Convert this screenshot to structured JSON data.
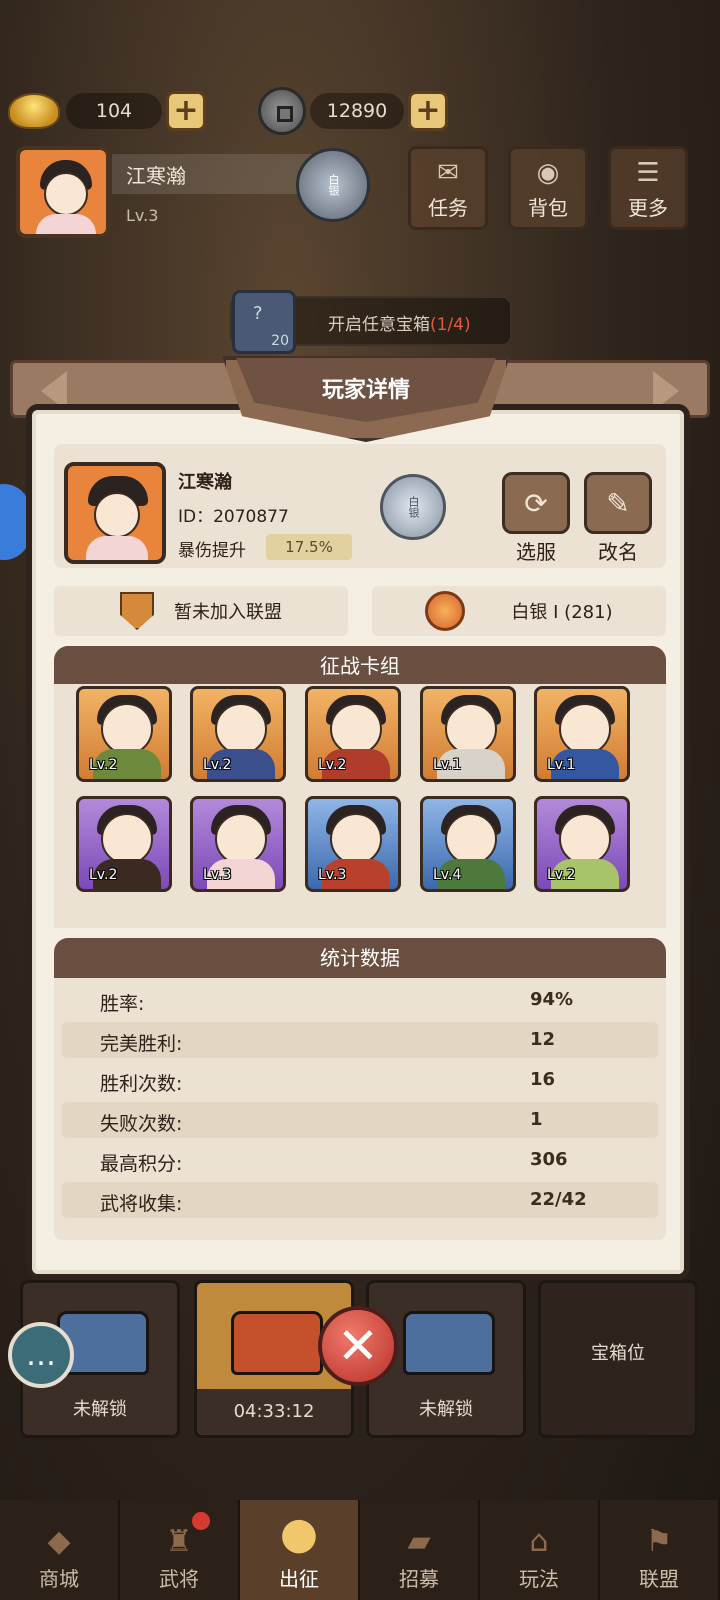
{
  "currency": {
    "ingot_value": "104",
    "coin_value": "12890"
  },
  "player_bar": {
    "name": "江寒瀚",
    "level": "Lv.3",
    "rank_label": "白银"
  },
  "top_buttons": [
    {
      "label": "任务"
    },
    {
      "label": "背包"
    },
    {
      "label": "更多"
    }
  ],
  "chest_task": {
    "icon_count": "20",
    "text": "开启任意宝箱",
    "progress": "(1/4)"
  },
  "panel": {
    "title": "玩家详情",
    "name": "江寒瀚",
    "id_text": "ID：2070877",
    "crit_label": "暴伤提升",
    "crit_value": "17.5%",
    "rank_label": "白银",
    "select_server": "选服",
    "rename": "改名",
    "alliance": "暂未加入联盟",
    "league": "白银 I (281)"
  },
  "deck": {
    "title": "征战卡组",
    "cards": [
      {
        "level": "Lv.2",
        "rarity": "orange"
      },
      {
        "level": "Lv.2",
        "rarity": "orange"
      },
      {
        "level": "Lv.2",
        "rarity": "orange"
      },
      {
        "level": "Lv.1",
        "rarity": "orange"
      },
      {
        "level": "Lv.1",
        "rarity": "orange"
      },
      {
        "level": "Lv.2",
        "rarity": "purple"
      },
      {
        "level": "Lv.3",
        "rarity": "purple"
      },
      {
        "level": "Lv.3",
        "rarity": "blue"
      },
      {
        "level": "Lv.4",
        "rarity": "blue"
      },
      {
        "level": "Lv.2",
        "rarity": "purple"
      }
    ]
  },
  "stats": {
    "title": "统计数据",
    "rows": [
      {
        "label": "胜率:",
        "value": "94%"
      },
      {
        "label": "完美胜利:",
        "value": "12"
      },
      {
        "label": "胜利次数:",
        "value": "16"
      },
      {
        "label": "失败次数:",
        "value": "1"
      },
      {
        "label": "最高积分:",
        "value": "306"
      },
      {
        "label": "武将收集:",
        "value": "22/42"
      }
    ]
  },
  "chest_slots": [
    {
      "label": "未解锁"
    },
    {
      "label": "04:33:12"
    },
    {
      "label": "未解锁"
    },
    {
      "label": "宝箱位"
    }
  ],
  "bottom_nav": [
    {
      "label": "商城"
    },
    {
      "label": "武将"
    },
    {
      "label": "出征"
    },
    {
      "label": "招募"
    },
    {
      "label": "玩法"
    },
    {
      "label": "联盟"
    }
  ],
  "colors": {
    "orange_card": "#d07d34",
    "purple_card": "#7c4ab8",
    "blue_card": "#3b69ad",
    "accent_gold": "#e1d19e",
    "close_red": "#b8302a"
  }
}
